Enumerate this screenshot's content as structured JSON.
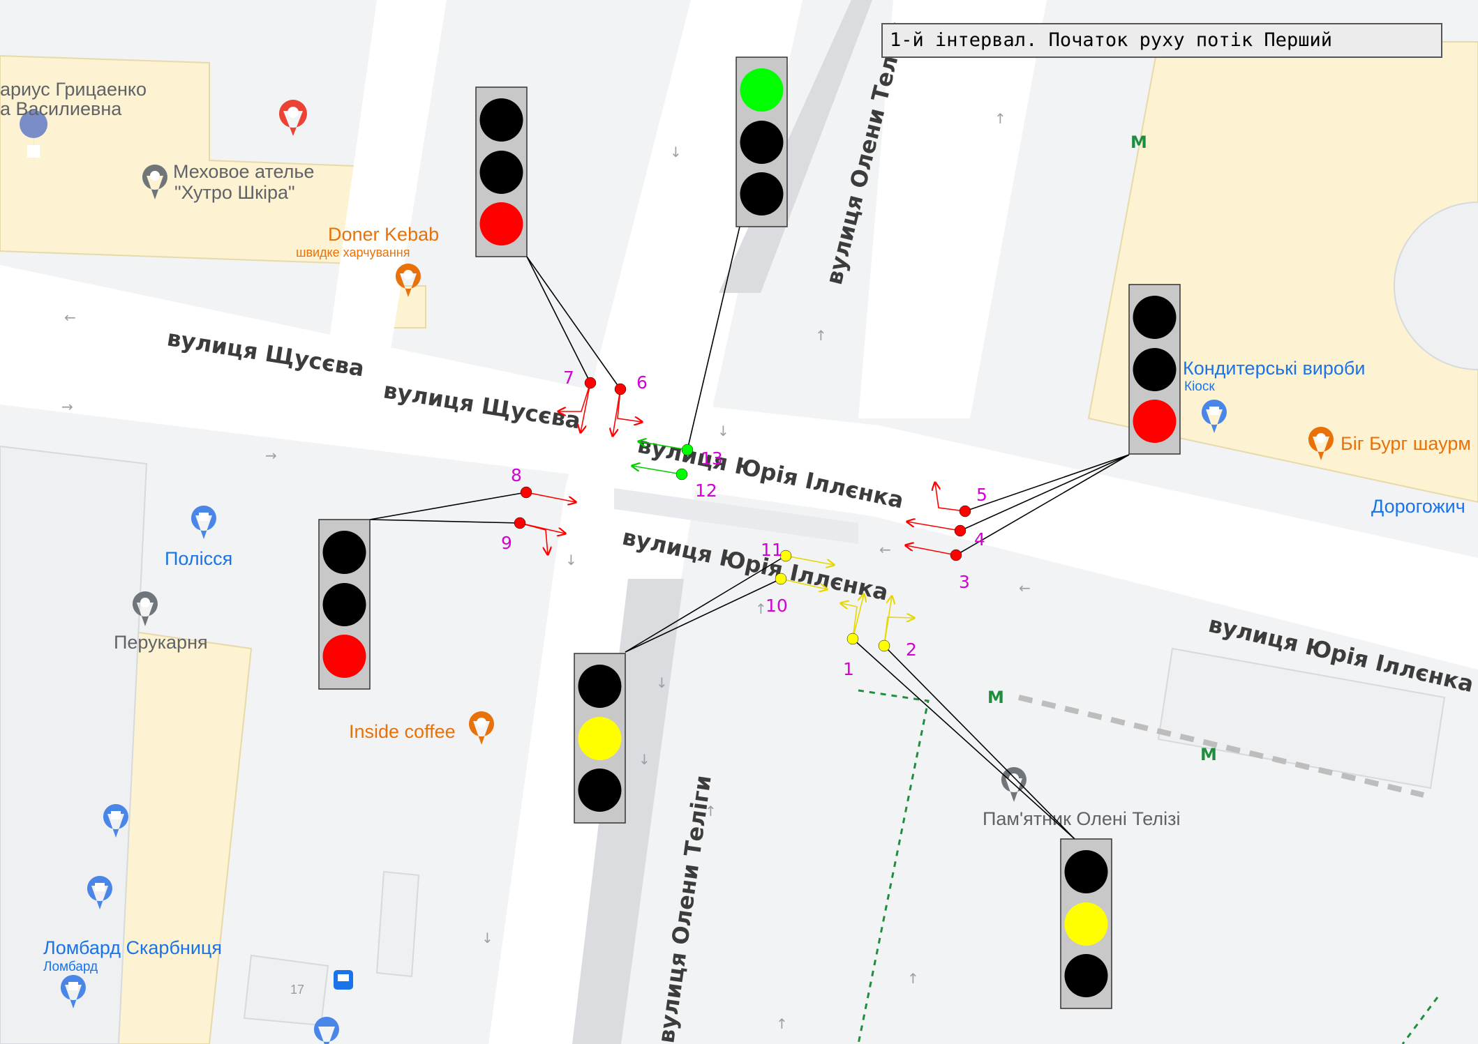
{
  "title": "1-й інтервал. Початок руху потік Перший",
  "map": {
    "streets": [
      {
        "id": "shchuseva-1",
        "label": "вулиця Щусєва"
      },
      {
        "id": "shchuseva-2",
        "label": "вулиця Щусєва"
      },
      {
        "id": "illenka-1",
        "label": "вулиця Юрія Іллєнка"
      },
      {
        "id": "illenka-2",
        "label": "вулиця Юрія Іллєнка"
      },
      {
        "id": "illenka-3",
        "label": "вулиця Юрія Іллєнка"
      },
      {
        "id": "teligi-1",
        "label": "вулиця Олени Теліги"
      },
      {
        "id": "teligi-2",
        "label": "вулиця Олени Теліги"
      }
    ],
    "pois": [
      {
        "id": "notary",
        "lines": [
          "ариус Грицаенко",
          "а Василиевна"
        ],
        "color": "#5f6368",
        "icon": "none"
      },
      {
        "id": "fur",
        "lines": [
          "Меховое ателье",
          "\"Хутро Шкіра\""
        ],
        "color": "#5f6368",
        "icon": "gray-pin-icon"
      },
      {
        "id": "doner",
        "lines": [
          "Doner Kebab",
          "швидке харчування"
        ],
        "color": "#e8710a",
        "icon": "restaurant-pin-icon"
      },
      {
        "id": "polissia",
        "lines": [
          "Полісся"
        ],
        "color": "#1a73e8",
        "icon": "shopping-pin-icon"
      },
      {
        "id": "barber",
        "lines": [
          "Перукарня"
        ],
        "color": "#5f6368",
        "icon": "gray-pin-icon"
      },
      {
        "id": "inside",
        "lines": [
          "Inside coffee"
        ],
        "color": "#e8710a",
        "icon": "coffee-pin-icon"
      },
      {
        "id": "lombard",
        "lines": [
          "Ломбард Скарбниця",
          "Ломбард"
        ],
        "color": "#1a73e8",
        "icon": "shopping-pin-icon"
      },
      {
        "id": "candy",
        "lines": [
          "Кондитерські вироби",
          "Кіоск"
        ],
        "color": "#1a73e8",
        "icon": "shopping-pin-icon"
      },
      {
        "id": "bigburg",
        "lines": [
          "Біг Бург шаурм"
        ],
        "color": "#e8710a",
        "icon": "coffee-pin-icon"
      },
      {
        "id": "dorogo",
        "lines": [
          "Дорогожич"
        ],
        "color": "#1a73e8",
        "icon": "none"
      },
      {
        "id": "monument",
        "lines": [
          "Пам'ятник Олені Телізі"
        ],
        "color": "#5f6368",
        "icon": "gray-pin-icon"
      },
      {
        "id": "building17",
        "lines": [
          "17"
        ],
        "color": "#9a9a9a",
        "icon": "none"
      }
    ],
    "metro": [
      {
        "label": "M"
      },
      {
        "label": "M"
      },
      {
        "label": "M"
      }
    ]
  },
  "traffic_lights": [
    {
      "id": "tl-top-left",
      "state": "red",
      "lamps": [
        "#000000",
        "#000000",
        "#ff0000"
      ]
    },
    {
      "id": "tl-top-center",
      "state": "green",
      "lamps": [
        "#00ff00",
        "#000000",
        "#000000"
      ]
    },
    {
      "id": "tl-right",
      "state": "red",
      "lamps": [
        "#000000",
        "#000000",
        "#ff0000"
      ]
    },
    {
      "id": "tl-left",
      "state": "red",
      "lamps": [
        "#000000",
        "#000000",
        "#ff0000"
      ]
    },
    {
      "id": "tl-bottom-center",
      "state": "yellow",
      "lamps": [
        "#000000",
        "#ffff00",
        "#000000"
      ]
    },
    {
      "id": "tl-bottom-right",
      "state": "yellow",
      "lamps": [
        "#000000",
        "#ffff00",
        "#000000"
      ]
    }
  ],
  "stop_points": [
    {
      "num": "1",
      "color": "#ffff00"
    },
    {
      "num": "2",
      "color": "#ffff00"
    },
    {
      "num": "3",
      "color": "#ff0000"
    },
    {
      "num": "4",
      "color": "#ff0000"
    },
    {
      "num": "5",
      "color": "#ff0000"
    },
    {
      "num": "6",
      "color": "#ff0000"
    },
    {
      "num": "7",
      "color": "#ff0000"
    },
    {
      "num": "8",
      "color": "#ff0000"
    },
    {
      "num": "9",
      "color": "#ff0000"
    },
    {
      "num": "10",
      "color": "#ffff00"
    },
    {
      "num": "11",
      "color": "#ffff00"
    },
    {
      "num": "12",
      "color": "#00ff00"
    },
    {
      "num": "13",
      "color": "#00ff00"
    }
  ],
  "colors": {
    "road": "#ffffff",
    "block": "#f1f3f4",
    "yellow_block": "#fdf2d1",
    "median": "#dadce0",
    "housing": "#c8c8c8",
    "lamp_off": "#000000",
    "red": "#ff0000",
    "yellow": "#ffff00",
    "green": "#00ff00",
    "label_magenta": "#d400d4"
  }
}
